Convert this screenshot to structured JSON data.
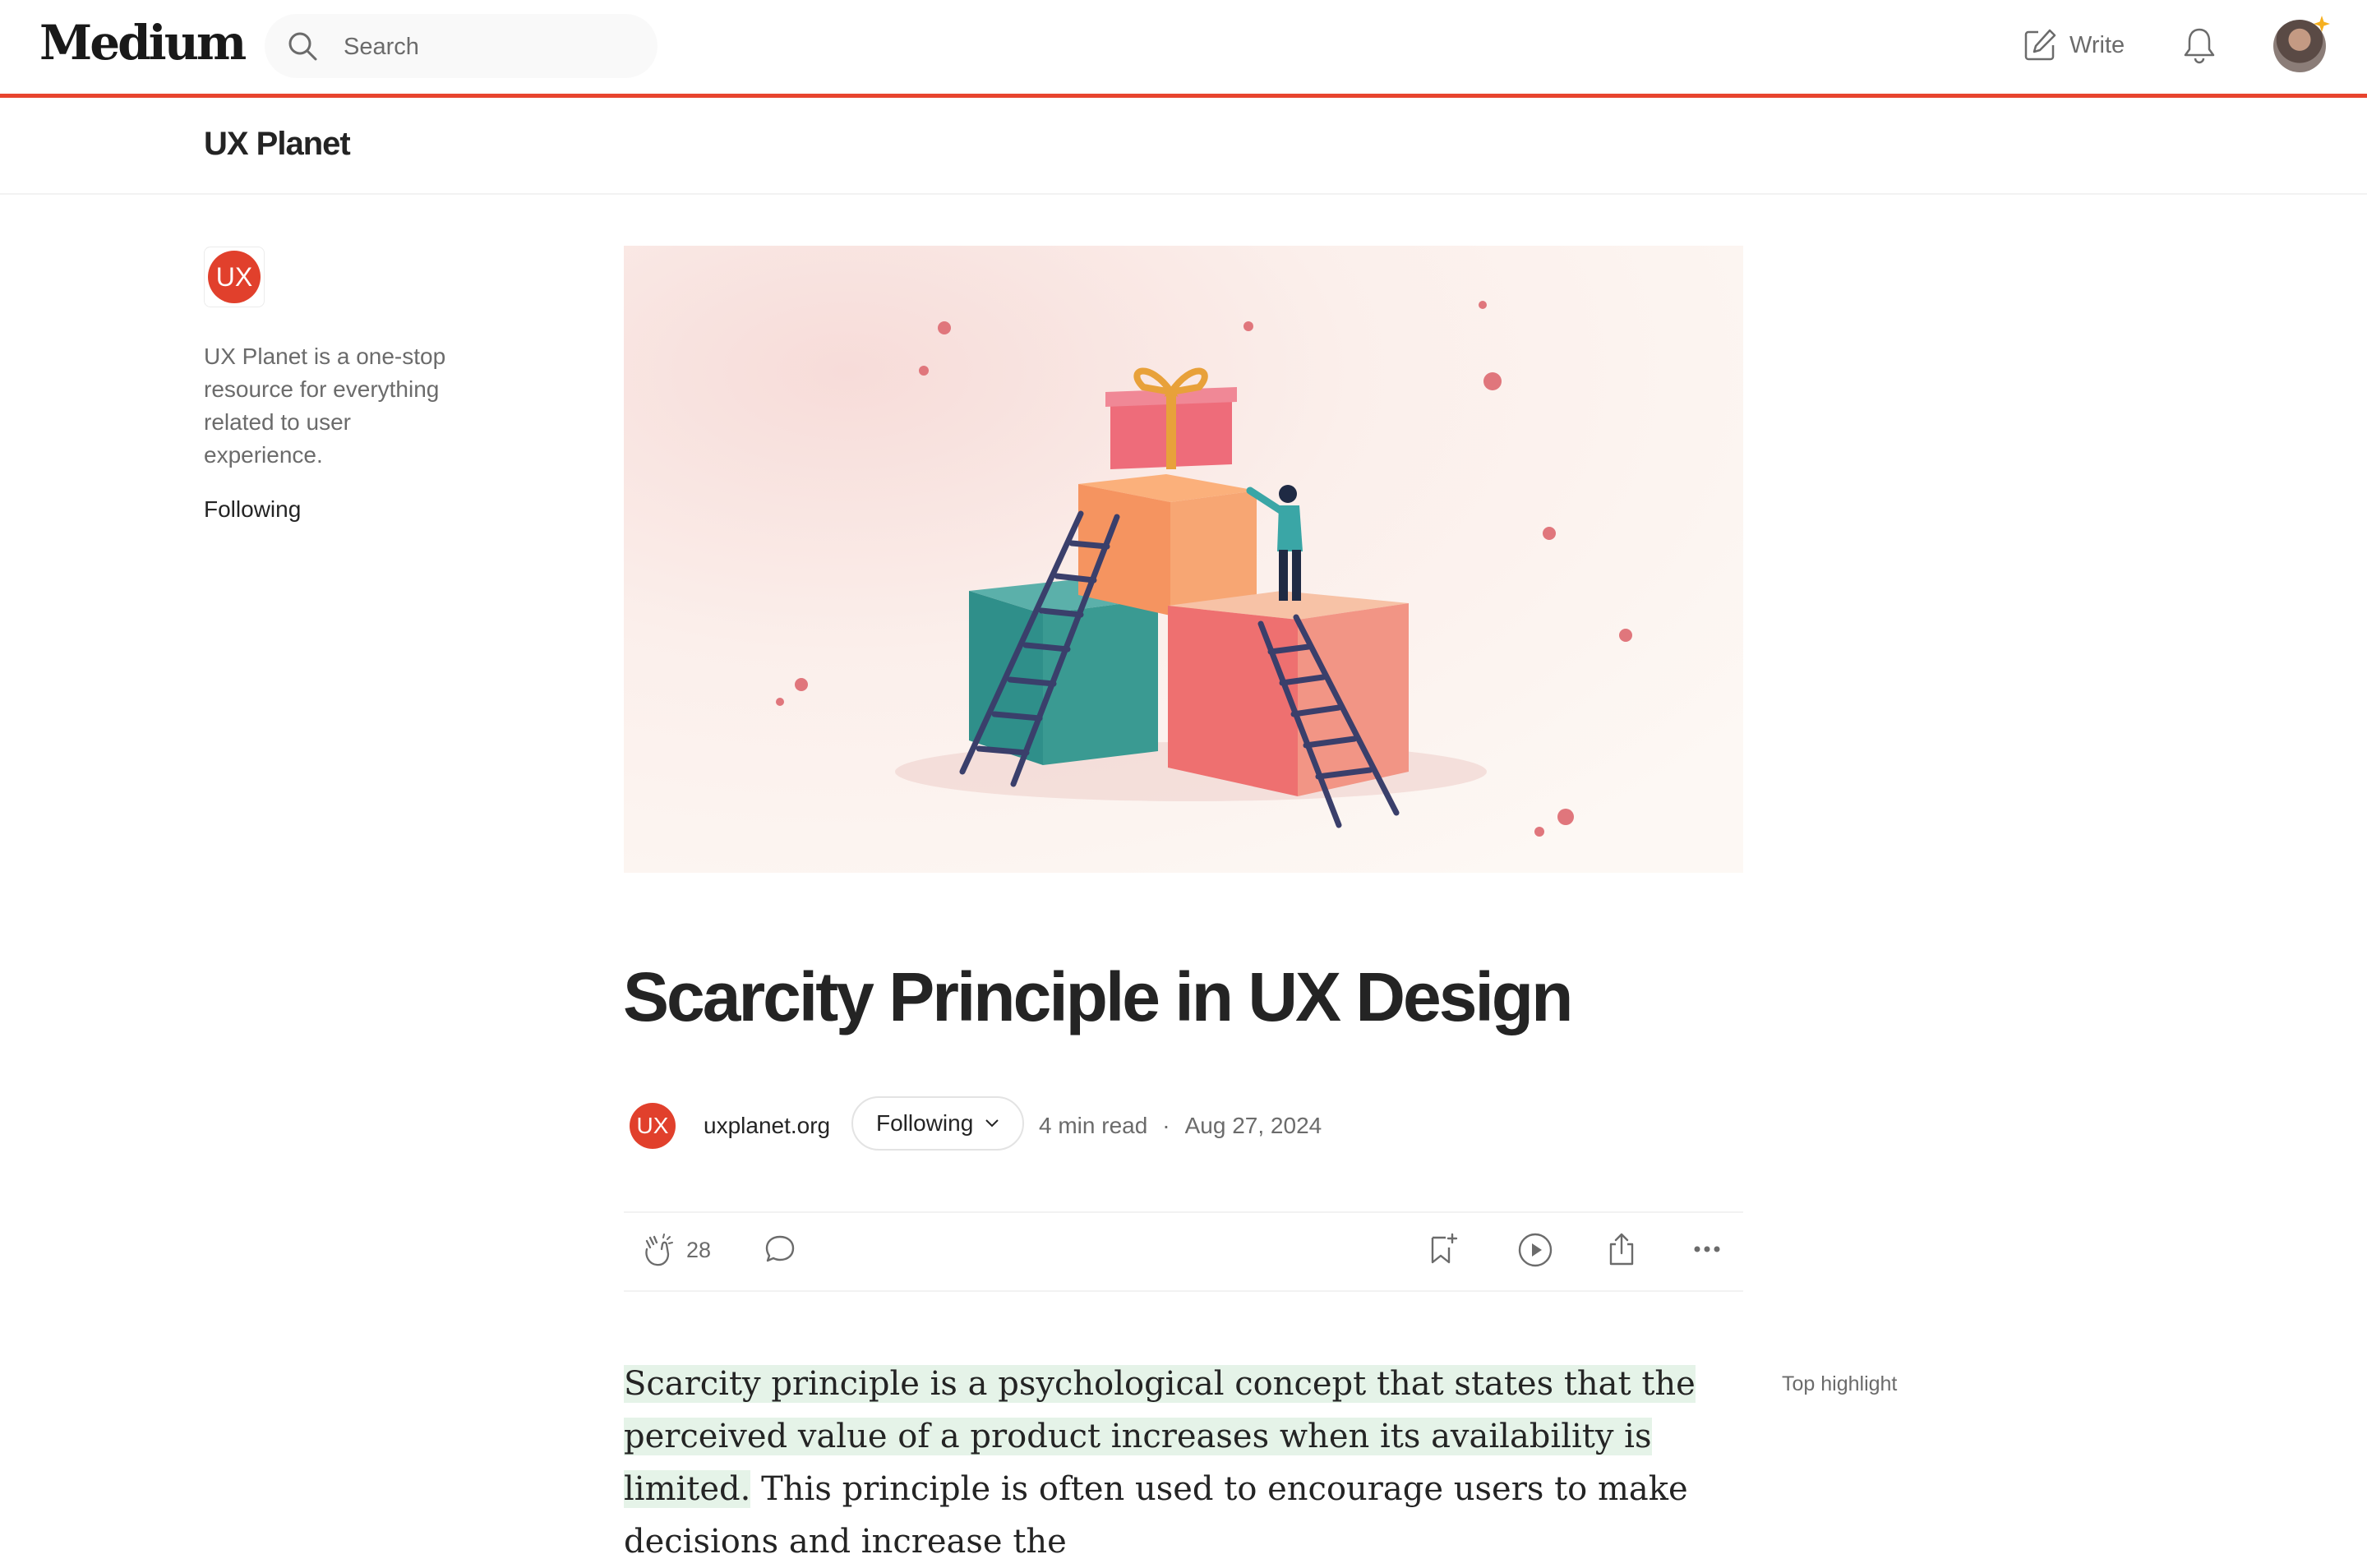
{
  "header": {
    "logo": "Medium",
    "search_placeholder": "Search",
    "write_label": "Write"
  },
  "publication": {
    "name": "UX Planet",
    "logo_text": "UX",
    "description": "UX Planet is a one-stop resource for everything related to user experience.",
    "follow_state": "Following"
  },
  "article": {
    "title": "Scarcity Principle in UX Design",
    "author": "uxplanet.org",
    "author_avatar_text": "UX",
    "following_label": "Following",
    "read_time": "4 min read",
    "separator": "·",
    "date": "Aug 27, 2024",
    "claps": "28",
    "highlight_text": "Scarcity principle is a psychological concept that states that the perceived value of a product increases when its availability is limited.",
    "continuation_text": " This principle is often used to encourage users to make decisions and increase the",
    "top_highlight_label": "Top highlight"
  },
  "colors": {
    "accent": "#e8442e",
    "brand_red": "#e1402c",
    "highlight_bg": "#e5f3e8",
    "muted_text": "#6b6b6b"
  },
  "icons": {
    "search": "search-icon",
    "write": "write-icon",
    "notifications": "bell-icon",
    "clap": "clap-icon",
    "comment": "comment-icon",
    "save": "bookmark-plus-icon",
    "listen": "play-icon",
    "share": "share-icon",
    "more": "more-icon"
  }
}
